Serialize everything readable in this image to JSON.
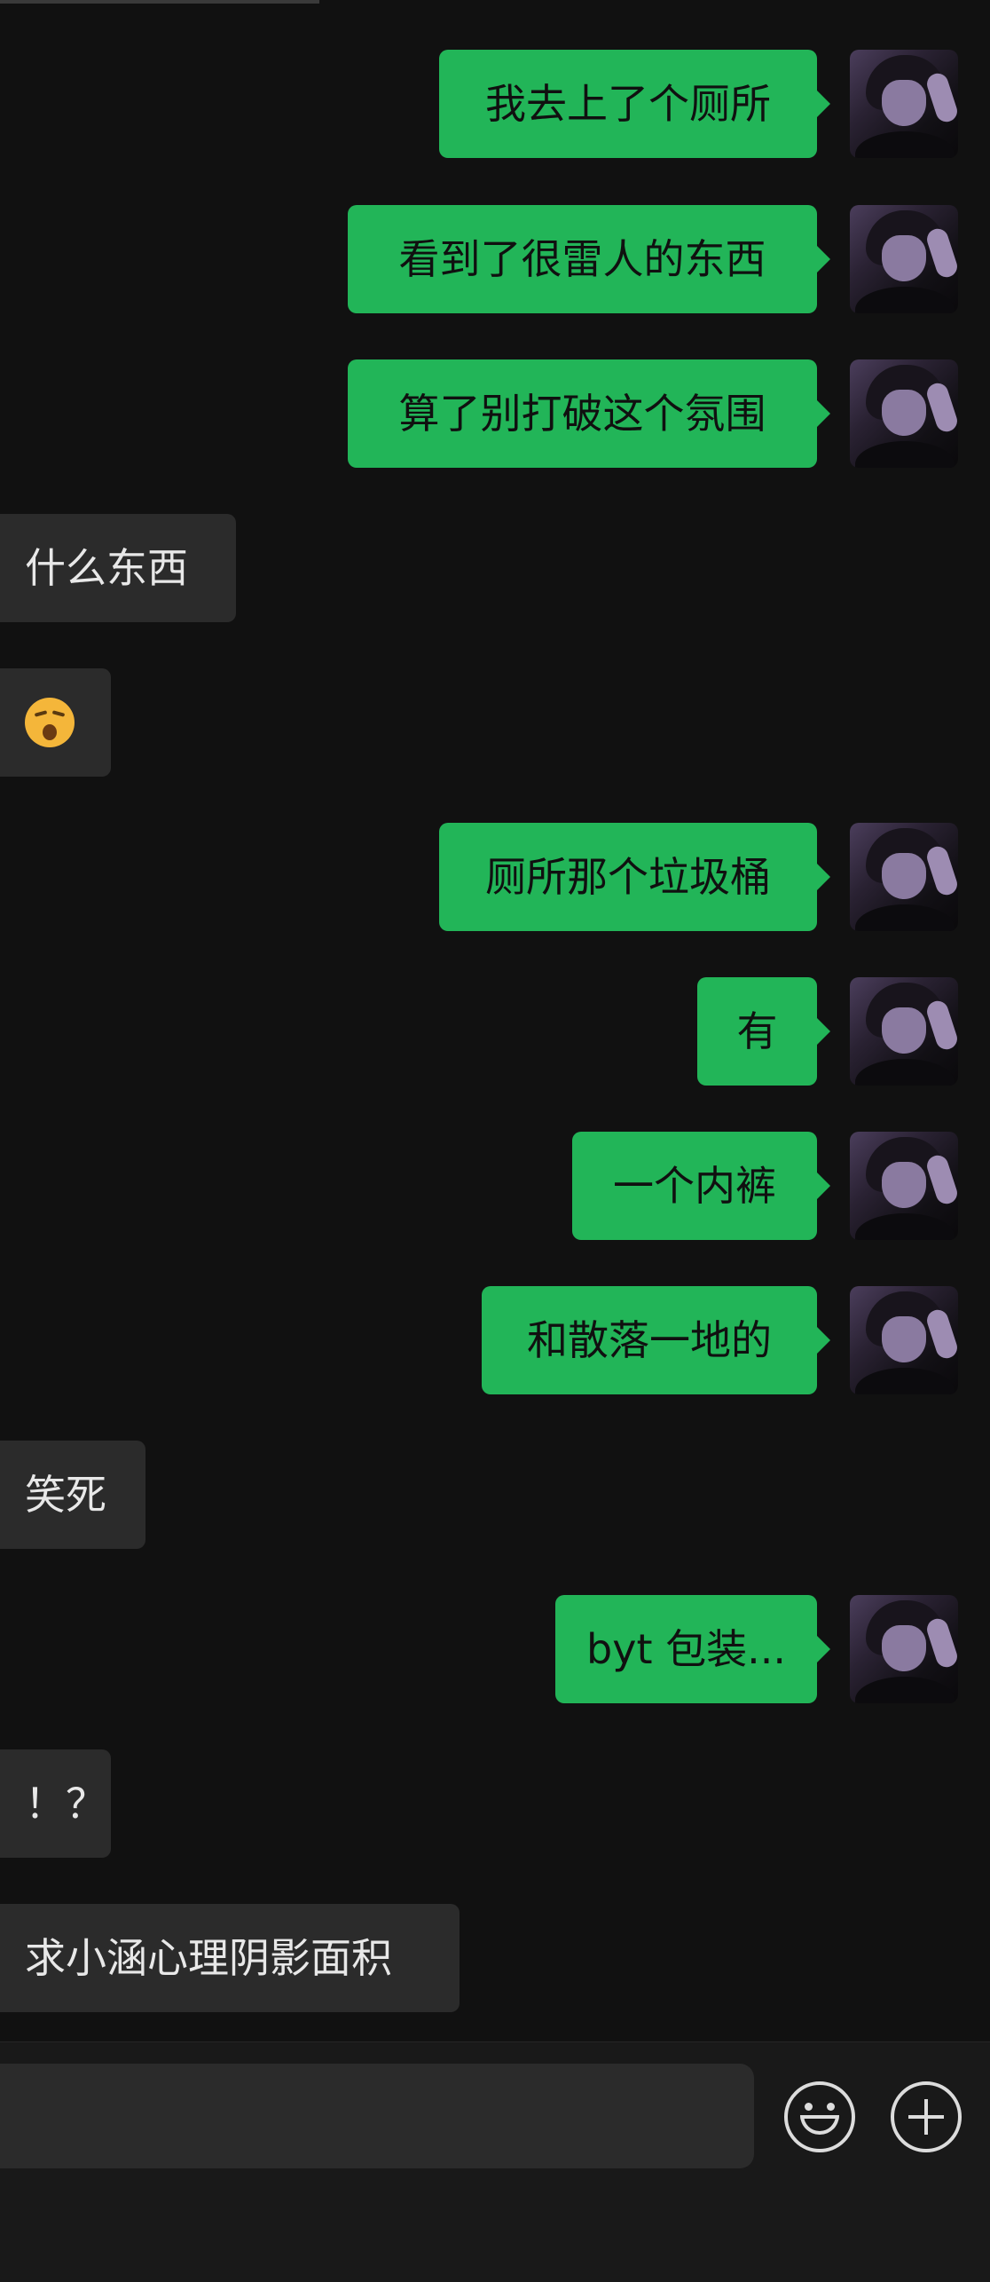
{
  "colors": {
    "background": "#111111",
    "outgoing_bubble": "#22b558",
    "incoming_bubble": "#2b2b2b",
    "input_bar": "#191919"
  },
  "messages": [
    {
      "direction": "out",
      "text": "我去上了个厕所"
    },
    {
      "direction": "out",
      "text": "看到了很雷人的东西"
    },
    {
      "direction": "out",
      "text": "算了别打破这个氛围"
    },
    {
      "direction": "in",
      "text": "什么东西"
    },
    {
      "direction": "in",
      "text": "",
      "emoji": "hushed-face-emoji"
    },
    {
      "direction": "out",
      "text": "厕所那个垃圾桶"
    },
    {
      "direction": "out",
      "text": "有"
    },
    {
      "direction": "out",
      "text": "一个内裤"
    },
    {
      "direction": "out",
      "text": "和散落一地的"
    },
    {
      "direction": "in",
      "text": "笑死"
    },
    {
      "direction": "out",
      "text": "byt 包装..."
    },
    {
      "direction": "in",
      "text": "！？"
    },
    {
      "direction": "in",
      "text": "求小涵心理阴影面积"
    }
  ],
  "input_bar": {
    "value": "",
    "emoji_icon": "smiley-icon",
    "plus_icon": "plus-circle-icon"
  }
}
